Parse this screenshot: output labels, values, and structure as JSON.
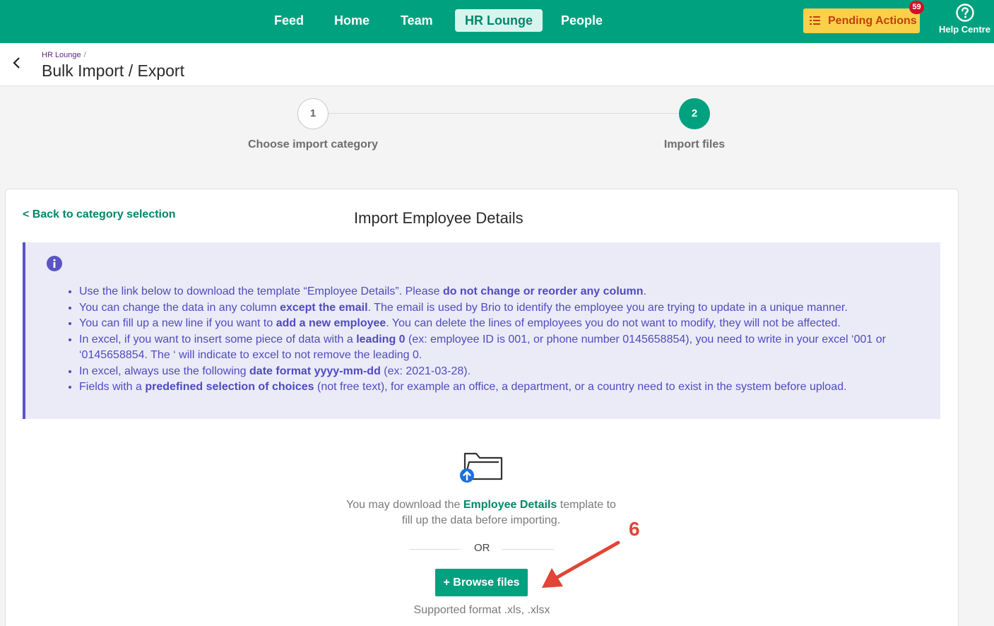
{
  "nav": {
    "tabs": [
      {
        "label": "Feed"
      },
      {
        "label": "Home"
      },
      {
        "label": "Team"
      },
      {
        "label": "HR Lounge",
        "active": true
      },
      {
        "label": "People"
      }
    ],
    "pending_actions": {
      "label": "Pending Actions",
      "count": "59",
      "icon": "list-icon"
    },
    "help": {
      "label": "Help Centre",
      "icon": "help-circle-icon"
    }
  },
  "header": {
    "breadcrumb": {
      "parent": "HR Lounge",
      "separator": "/"
    },
    "title": "Bulk Import / Export"
  },
  "stepper": {
    "steps": [
      {
        "number": "1",
        "label": "Choose import category",
        "state": "completed"
      },
      {
        "number": "2",
        "label": "Import files",
        "state": "current"
      }
    ]
  },
  "card": {
    "back_link": "< Back to category selection",
    "title": "Import Employee Details",
    "info": {
      "icon": "info-icon",
      "items": [
        [
          {
            "t": "Use the link below to download the template “Employee Details”. Please "
          },
          {
            "t": "do not change or reorder any column",
            "b": true
          },
          {
            "t": "."
          }
        ],
        [
          {
            "t": "You can change the data in any column "
          },
          {
            "t": "except the email",
            "b": true
          },
          {
            "t": ". The email is used by Brio to identify the employee you are trying to update in a unique manner."
          }
        ],
        [
          {
            "t": "You can fill up a new line if you want to "
          },
          {
            "t": "add a new employee",
            "b": true
          },
          {
            "t": ". You can delete the lines of employees you do not want to modify, they will not be affected."
          }
        ],
        [
          {
            "t": "In excel, if you want to insert some piece of data with a "
          },
          {
            "t": "leading 0",
            "b": true
          },
          {
            "t": " (ex: employee ID is 001, or phone number 0145658854), you need to write in your excel ‘001 or ‘0145658854. The ‘ will indicate to excel to not remove the leading 0."
          }
        ],
        [
          {
            "t": "In excel, always use the following "
          },
          {
            "t": "date format yyyy-mm-dd",
            "b": true
          },
          {
            "t": " (ex: 2021-03-28)."
          }
        ],
        [
          {
            "t": "Fields with a "
          },
          {
            "t": "predefined selection of choices",
            "b": true
          },
          {
            "t": " (not free text), for example an office, a department, or a country need to exist in the system before upload."
          }
        ]
      ]
    },
    "upload": {
      "icon": "folder-upload-icon",
      "text_before": "You may download the ",
      "template_link": "Employee Details",
      "text_after": " template to fill up the data before importing.",
      "or_label": "OR",
      "browse_button": "+ Browse files",
      "supported": "Supported format .xls, .xlsx"
    }
  },
  "annotation": {
    "number": "6",
    "color": "#e04535"
  },
  "colors": {
    "primary": "#00a17f",
    "info_text": "#4f4bbd",
    "info_bg": "#ebebf8",
    "pending_bg": "#f9d04a",
    "badge": "#d0112b"
  }
}
